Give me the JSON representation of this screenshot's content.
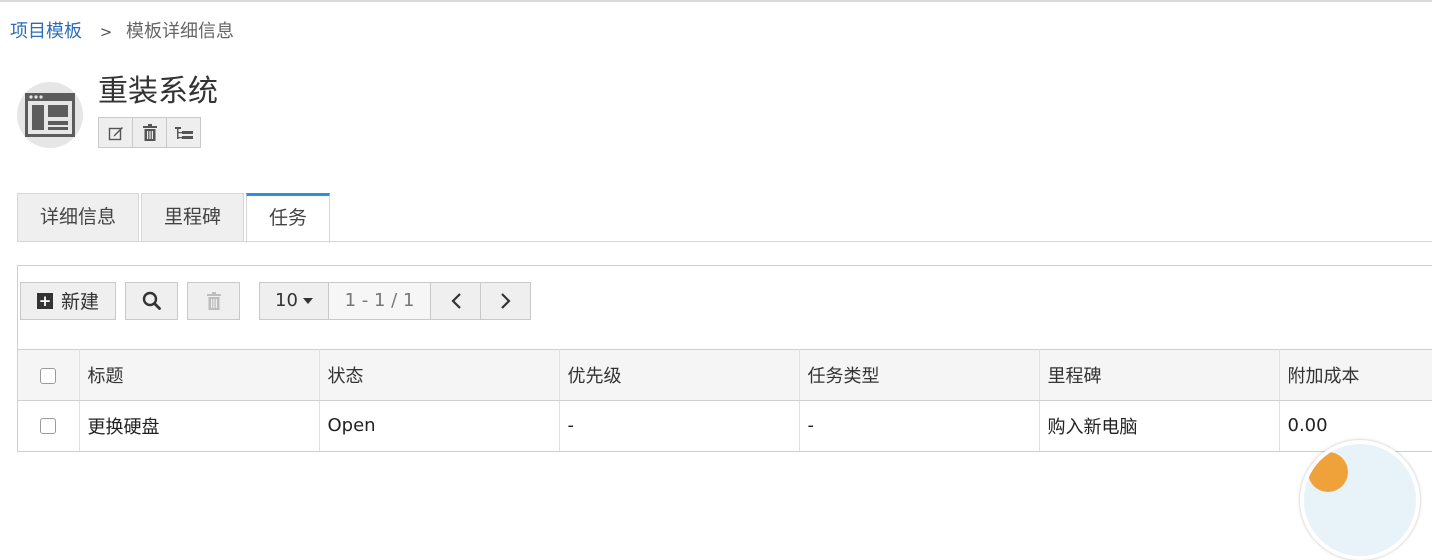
{
  "breadcrumb": {
    "parent": "项目模板",
    "separator": ">",
    "current": "模板详细信息"
  },
  "page": {
    "title": "重装系统"
  },
  "actions": {
    "edit_icon": "edit-icon",
    "delete_icon": "trash-icon",
    "tree_icon": "tree-icon"
  },
  "tabs": [
    {
      "label": "详细信息",
      "active": false
    },
    {
      "label": "里程碑",
      "active": false
    },
    {
      "label": "任务",
      "active": true
    }
  ],
  "toolbar": {
    "new_label": "新建",
    "page_size": "10",
    "page_info": "1 - 1 / 1"
  },
  "table": {
    "headers": [
      "标题",
      "状态",
      "优先级",
      "任务类型",
      "里程碑",
      "附加成本"
    ],
    "rows": [
      {
        "title": "更换硬盘",
        "status": "Open",
        "priority": "-",
        "type": "-",
        "milestone": "购入新电脑",
        "cost": "0.00"
      }
    ]
  },
  "colors": {
    "link": "#2a6ebb",
    "tab_active_border": "#2a93d5"
  }
}
